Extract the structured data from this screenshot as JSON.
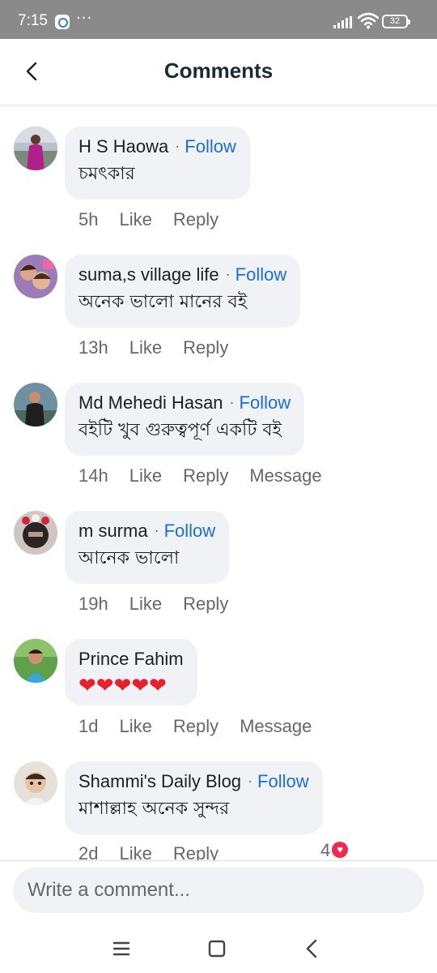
{
  "status_bar": {
    "time": "7:15",
    "dots": "···",
    "battery": "32"
  },
  "header": {
    "title": "Comments"
  },
  "comments": [
    {
      "author": "H S Haowa",
      "follow": "Follow",
      "text": "চমৎকার",
      "time": "5h",
      "like": "Like",
      "reply": "Reply"
    },
    {
      "author": "suma,s village life",
      "follow": "Follow",
      "text": "অনেক ভালো মানের বই",
      "time": "13h",
      "like": "Like",
      "reply": "Reply"
    },
    {
      "author": "Md Mehedi Hasan",
      "follow": "Follow",
      "text": "বইটি খুব গুরুত্বপূর্ণ একটি বই",
      "time": "14h",
      "like": "Like",
      "reply": "Reply",
      "message": "Message"
    },
    {
      "author": "m surma",
      "follow": "Follow",
      "text": "আনেক ভালো",
      "time": "19h",
      "like": "Like",
      "reply": "Reply"
    },
    {
      "author": "Prince Fahim",
      "text": "❤❤❤❤❤",
      "time": "1d",
      "like": "Like",
      "reply": "Reply",
      "message": "Message"
    },
    {
      "author": "Shammi's Daily Blog",
      "follow": "Follow",
      "text": "মাশাল্লাহ অনেক সুন্দর",
      "time": "2d",
      "like": "Like",
      "reply": "Reply",
      "reaction_count": "4"
    }
  ],
  "composer": {
    "placeholder": "Write a comment..."
  },
  "colors": {
    "accent": "#1a6ed8",
    "bubble": "#f0f2f5",
    "heart": "#f02849"
  }
}
